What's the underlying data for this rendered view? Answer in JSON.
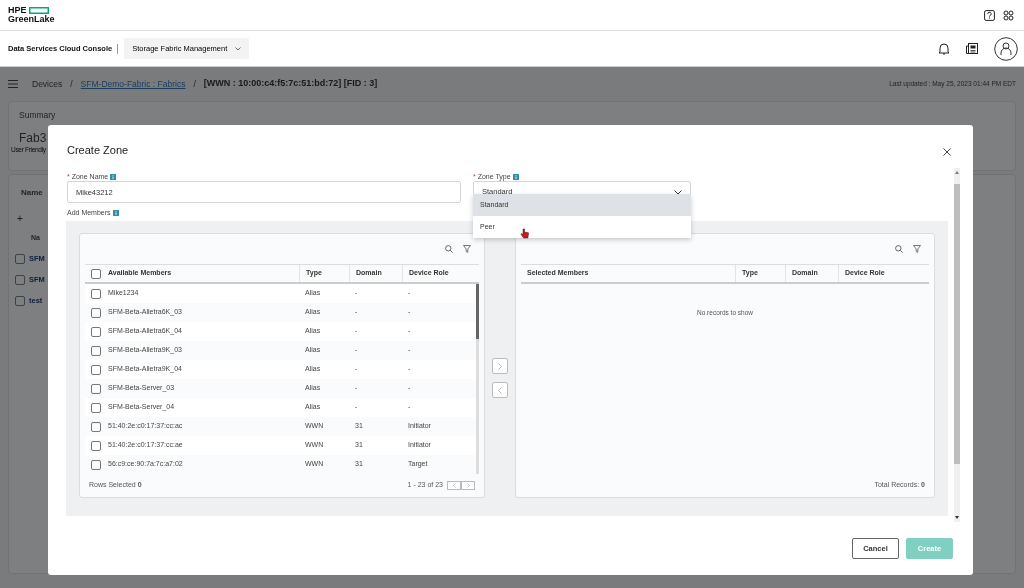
{
  "header": {
    "logo_top": "HPE",
    "logo_bottom": "GreenLake",
    "console": "Data Services Cloud Console",
    "app_select": "Storage Fabric Management"
  },
  "breadcrumb": {
    "separator": "/",
    "items": [
      {
        "label": "Devices",
        "link": false
      },
      {
        "label": "SFM-Demo-Fabric : Fabrics",
        "link": true
      },
      {
        "label": "[WWN : 10:00:c4:f5:7c:51:bd:72] [FID : 3]",
        "link": false
      }
    ]
  },
  "last_updated": "Last updated : May 25, 2023 01:44 PM EDT",
  "background": {
    "summary_title": "Summary",
    "name": "Fab3",
    "subtitle": "User Friendly",
    "section_title": "Name",
    "add": "+",
    "column": "Na",
    "rows": [
      {
        "label": "SFM",
        "checked": false
      },
      {
        "label": "SFM",
        "checked": false
      },
      {
        "label": "test",
        "checked": false
      }
    ]
  },
  "modal": {
    "title": "Create Zone",
    "zone_name": {
      "required_mark": "*",
      "label": "Zone Name",
      "value": "Mike43212"
    },
    "zone_type": {
      "required_mark": "*",
      "label": "Zone Type",
      "value": "Standard",
      "expanded": true,
      "options": [
        {
          "label": "Standard",
          "selected": true
        },
        {
          "label": "Peer",
          "selected": false
        }
      ]
    },
    "add_members_label": "Add Members",
    "available": {
      "all_checked": false,
      "columns": [
        "Available Members",
        "Type",
        "Domain",
        "Device Role"
      ],
      "rows": [
        {
          "cells": [
            "Mike1234",
            "Alias",
            "-",
            "-"
          ],
          "checked": false
        },
        {
          "cells": [
            "SFM-Beta-Alletra6K_03",
            "Alias",
            "-",
            "-"
          ],
          "checked": false
        },
        {
          "cells": [
            "SFM-Beta-Alletra6K_04",
            "Alias",
            "-",
            "-"
          ],
          "checked": false
        },
        {
          "cells": [
            "SFM-Beta-Alletra9K_03",
            "Alias",
            "-",
            "-"
          ],
          "checked": false
        },
        {
          "cells": [
            "SFM-Beta-Alletra9K_04",
            "Alias",
            "-",
            "-"
          ],
          "checked": false
        },
        {
          "cells": [
            "SFM-Beta-Server_03",
            "Alias",
            "-",
            "-"
          ],
          "checked": false
        },
        {
          "cells": [
            "SFM-Beta-Server_04",
            "Alias",
            "-",
            "-"
          ],
          "checked": false
        },
        {
          "cells": [
            "51:40:2e:c0:17:37:cc:ac",
            "WWN",
            "31",
            "Initiator"
          ],
          "checked": false
        },
        {
          "cells": [
            "51:40:2e:c0:17:37:cc:ae",
            "WWN",
            "31",
            "Initiator"
          ],
          "checked": false
        },
        {
          "cells": [
            "56:c9:ce:90:7a:7c:a7:02",
            "WWN",
            "31",
            "Target"
          ],
          "checked": false
        }
      ],
      "rows_selected": "Rows Selected **0**",
      "pagination": "1 - 23 of 23"
    },
    "selected": {
      "columns": [
        "Selected Members",
        "Type",
        "Domain",
        "Device Role"
      ],
      "empty": "No records to show",
      "total": "Total Records: **0**"
    },
    "buttons": [
      {
        "label": "Cancel",
        "kind": "secondary",
        "disabled": false
      },
      {
        "label": "Create",
        "kind": "primary",
        "disabled": true
      }
    ]
  }
}
